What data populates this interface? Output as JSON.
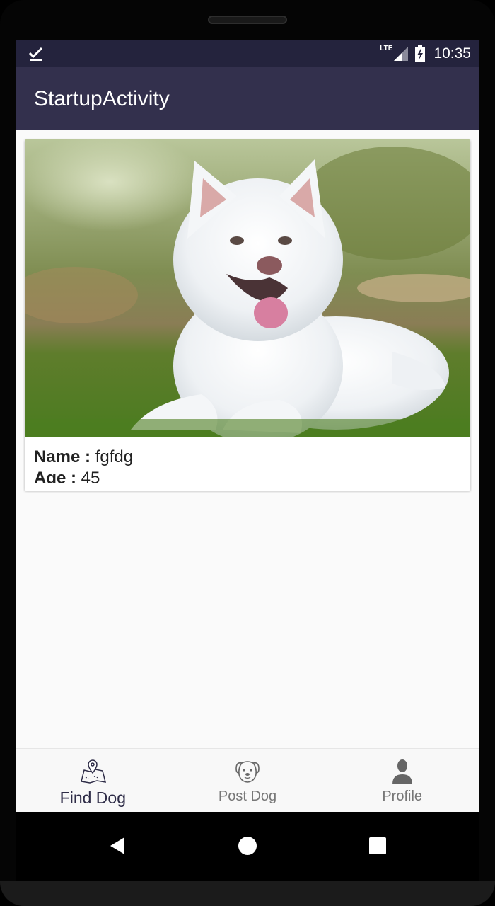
{
  "status_bar": {
    "network": "LTE",
    "time": "10:35",
    "icons": [
      "download-done-icon",
      "signal-icon",
      "battery-charging-icon"
    ]
  },
  "app_bar": {
    "title": "StartupActivity"
  },
  "dog_card": {
    "image": "white-samoyed-dog-photo",
    "name_label": "Name :",
    "name_value": "fgfdg",
    "age_label": "Age :",
    "age_value": "45"
  },
  "bottom_nav": {
    "items": [
      {
        "label": "Find Dog",
        "icon": "map-pin-icon",
        "active": true
      },
      {
        "label": "Post Dog",
        "icon": "dog-face-icon",
        "active": false
      },
      {
        "label": "Profile",
        "icon": "person-icon",
        "active": false
      }
    ]
  },
  "system_nav": {
    "buttons": [
      "back-icon",
      "home-icon",
      "recents-icon"
    ]
  },
  "colors": {
    "status_bar": "#24233d",
    "app_bar": "#33304d",
    "background": "#fafafa",
    "nav_active": "#2e2c47",
    "nav_inactive": "#777777"
  }
}
